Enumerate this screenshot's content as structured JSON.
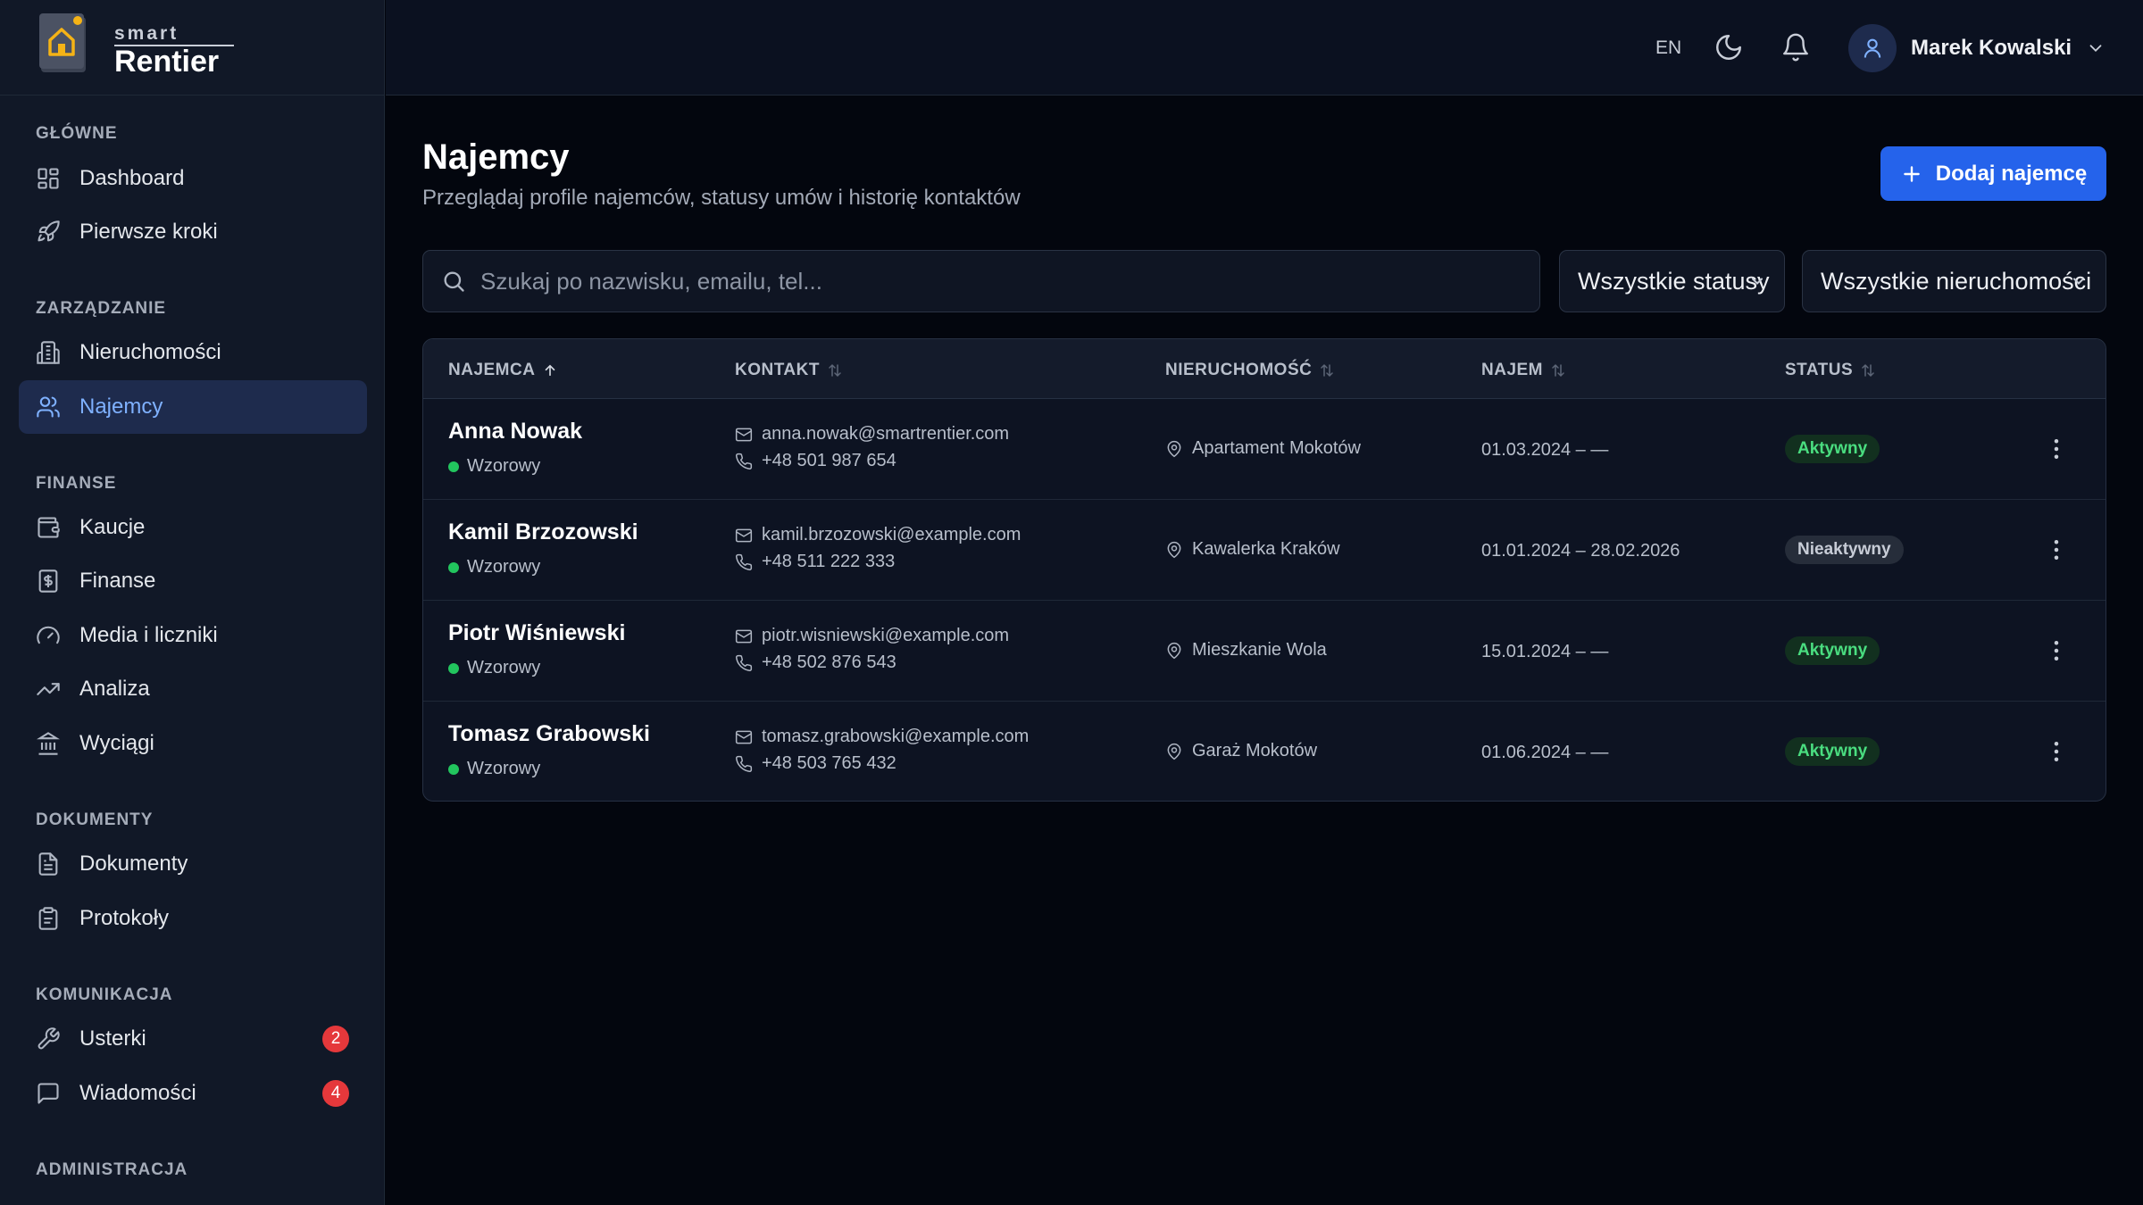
{
  "brand": {
    "small": "smart",
    "big": "Rentier"
  },
  "sidebar": {
    "sections": [
      {
        "title": "GŁÓWNE"
      },
      {
        "title": "ZARZĄDZANIE"
      },
      {
        "title": "FINANSE"
      },
      {
        "title": "DOKUMENTY"
      },
      {
        "title": "KOMUNIKACJA"
      },
      {
        "title": "ADMINISTRACJA"
      }
    ],
    "items": [
      {
        "label": "Dashboard",
        "icon": "dashboard-icon"
      },
      {
        "label": "Pierwsze kroki",
        "icon": "rocket-icon"
      },
      {
        "label": "Nieruchomości",
        "icon": "building-icon"
      },
      {
        "label": "Najemcy",
        "icon": "users-icon",
        "active": true
      },
      {
        "label": "Kaucje",
        "icon": "wallet-icon"
      },
      {
        "label": "Finanse",
        "icon": "dollar-icon"
      },
      {
        "label": "Media i liczniki",
        "icon": "gauge-icon"
      },
      {
        "label": "Analiza",
        "icon": "trend-icon"
      },
      {
        "label": "Wyciągi",
        "icon": "bank-icon"
      },
      {
        "label": "Dokumenty",
        "icon": "document-icon"
      },
      {
        "label": "Protokoły",
        "icon": "clipboard-icon"
      },
      {
        "label": "Usterki",
        "icon": "wrench-icon",
        "badge": "2"
      },
      {
        "label": "Wiadomości",
        "icon": "message-icon",
        "badge": "4"
      }
    ]
  },
  "topbar": {
    "lang": "EN",
    "theme_icon": "moon-icon",
    "notifications_icon": "bell-icon",
    "user_name": "Marek Kowalski"
  },
  "page": {
    "title": "Najemcy",
    "subtitle": "Przeglądaj profile najemców, statusy umów i historię kontaktów",
    "add_button": "Dodaj najemcę"
  },
  "filters": {
    "search_placeholder": "Szukaj po nazwisku, emailu, tel...",
    "status_select": "Wszystkie statusy",
    "property_select": "Wszystkie nieruchomości"
  },
  "table": {
    "columns": [
      "NAJEMCA",
      "KONTAKT",
      "NIERUCHOMOŚĆ",
      "NAJEM",
      "STATUS"
    ],
    "rows": [
      {
        "name": "Anna Nowak",
        "quality": "Wzorowy",
        "email": "anna.nowak@smartrentier.com",
        "phone": "+48 501 987 654",
        "property": "Apartament Mokotów",
        "lease": "01.03.2024 – —",
        "status": "Aktywny",
        "active": true
      },
      {
        "name": "Kamil Brzozowski",
        "quality": "Wzorowy",
        "email": "kamil.brzozowski@example.com",
        "phone": "+48 511 222 333",
        "property": "Kawalerka Kraków",
        "lease": "01.01.2024 – 28.02.2026",
        "status": "Nieaktywny",
        "active": false
      },
      {
        "name": "Piotr Wiśniewski",
        "quality": "Wzorowy",
        "email": "piotr.wisniewski@example.com",
        "phone": "+48 502 876 543",
        "property": "Mieszkanie Wola",
        "lease": "15.01.2024 – —",
        "status": "Aktywny",
        "active": true
      },
      {
        "name": "Tomasz Grabowski",
        "quality": "Wzorowy",
        "email": "tomasz.grabowski@example.com",
        "phone": "+48 503 765 432",
        "property": "Garaż Mokotów",
        "lease": "01.06.2024 – —",
        "status": "Aktywny",
        "active": true
      }
    ]
  },
  "colors": {
    "accent": "#2563eb",
    "active_nav": "#7fb1ff",
    "success": "#4ade80",
    "danger": "#e5383b"
  }
}
